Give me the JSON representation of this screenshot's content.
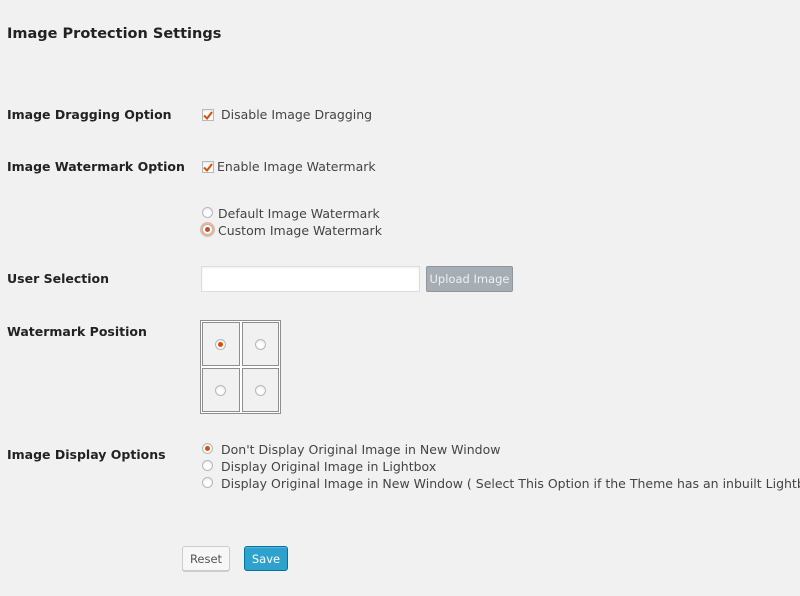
{
  "page": {
    "title": "Image Protection Settings"
  },
  "dragging": {
    "label": "Image Dragging Option",
    "checkbox_label": "Disable Image Dragging",
    "checked": true
  },
  "watermark": {
    "label": "Image Watermark Option",
    "checkbox_label": "Enable Image Watermark",
    "checked": true,
    "options": [
      {
        "label": "Default Image Watermark",
        "selected": false
      },
      {
        "label": "Custom Image Watermark",
        "selected": true
      }
    ]
  },
  "user_selection": {
    "label": "User Selection",
    "value": "",
    "upload_label": "Upload Image"
  },
  "position": {
    "label": "Watermark Position",
    "cells": [
      {
        "selected": true
      },
      {
        "selected": false
      },
      {
        "selected": false
      },
      {
        "selected": false
      }
    ]
  },
  "display": {
    "label": "Image Display Options",
    "options": [
      {
        "label": "Don't Display Original Image in New Window",
        "selected": true
      },
      {
        "label": "Display Original Image in Lightbox",
        "selected": false
      },
      {
        "label": "Display Original Image in New Window ( Select This Option if the Theme has an inbuilt Lightbox. )",
        "selected": false
      }
    ]
  },
  "actions": {
    "reset_label": "Reset",
    "save_label": "Save"
  },
  "colors": {
    "accent": "#d64e07",
    "primary_button": "#2ea2cc",
    "background": "#f1f1f1"
  },
  "icons": {
    "check": "checkmark-icon"
  }
}
